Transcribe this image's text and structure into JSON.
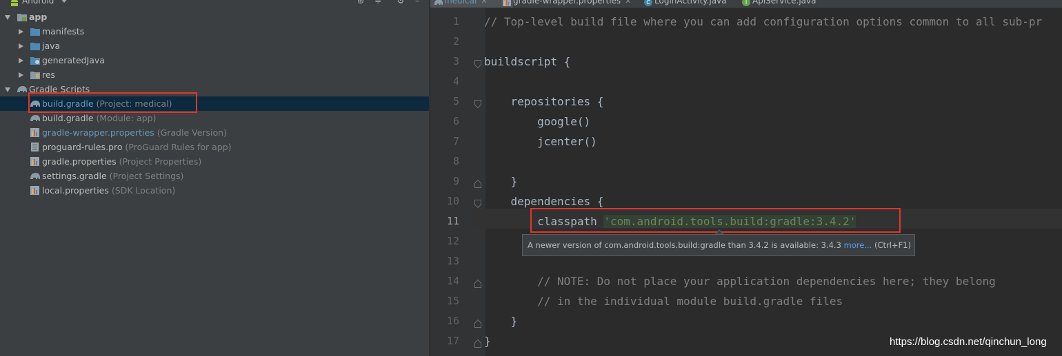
{
  "project_panel": {
    "view_label": "Android",
    "tree": [
      {
        "label": "app",
        "hint": "",
        "icon": "module-folder-icon",
        "expanded": true
      },
      {
        "label": "manifests",
        "hint": "",
        "icon": "folder-icon"
      },
      {
        "label": "java",
        "hint": "",
        "icon": "folder-icon"
      },
      {
        "label": "generatedJava",
        "hint": "",
        "icon": "generated-folder-icon"
      },
      {
        "label": "res",
        "hint": "",
        "icon": "res-folder-icon"
      },
      {
        "label": "Gradle Scripts",
        "hint": "",
        "icon": "gradle-elephant-icon",
        "expanded": true
      },
      {
        "label": "build.gradle",
        "hint": "(Project: medical)",
        "icon": "gradle-elephant-icon",
        "selected": true
      },
      {
        "label": "build.gradle",
        "hint": "(Module: app)",
        "icon": "gradle-elephant-icon"
      },
      {
        "label": "gradle-wrapper.properties",
        "hint": "(Gradle Version)",
        "icon": "properties-file-icon"
      },
      {
        "label": "proguard-rules.pro",
        "hint": "(ProGuard Rules for app)",
        "icon": "text-file-icon"
      },
      {
        "label": "gradle.properties",
        "hint": "(Project Properties)",
        "icon": "properties-file-icon"
      },
      {
        "label": "settings.gradle",
        "hint": "(Project Settings)",
        "icon": "gradle-elephant-icon"
      },
      {
        "label": "local.properties",
        "hint": "(SDK Location)",
        "icon": "properties-file-icon"
      }
    ]
  },
  "tabs": [
    {
      "label": "medical",
      "active": true
    },
    {
      "label": "gradle-wrapper.properties"
    },
    {
      "label": "LoginActivity.java"
    },
    {
      "label": "ApiService.java"
    }
  ],
  "editor": {
    "current_line": 11,
    "lines": [
      {
        "n": "1",
        "parts": [
          {
            "t": "// Top-level build file where you can add configuration options common to all sub-pr",
            "s": "comment"
          }
        ]
      },
      {
        "n": "2",
        "parts": []
      },
      {
        "n": "3",
        "parts": [
          {
            "t": "buildscript {",
            "s": "plain"
          }
        ]
      },
      {
        "n": "4",
        "parts": []
      },
      {
        "n": "5",
        "parts": [
          {
            "t": "    repositories {",
            "s": "plain"
          }
        ]
      },
      {
        "n": "6",
        "parts": [
          {
            "t": "        google()",
            "s": "plain"
          }
        ]
      },
      {
        "n": "7",
        "parts": [
          {
            "t": "        jcenter()",
            "s": "plain"
          }
        ]
      },
      {
        "n": "8",
        "parts": []
      },
      {
        "n": "9",
        "parts": [
          {
            "t": "    }",
            "s": "plain"
          }
        ]
      },
      {
        "n": "10",
        "parts": [
          {
            "t": "    dependencies {",
            "s": "plain"
          }
        ]
      },
      {
        "n": "11",
        "parts": [
          {
            "t": "        classpath ",
            "s": "plain"
          },
          {
            "t": "'com.android.tools.build:gradle:3.4.2'",
            "s": "string"
          }
        ]
      },
      {
        "n": "12",
        "parts": []
      },
      {
        "n": "13",
        "parts": []
      },
      {
        "n": "14",
        "parts": [
          {
            "t": "        // NOTE: Do not place your application dependencies here; they belong",
            "s": "comment"
          }
        ]
      },
      {
        "n": "15",
        "parts": [
          {
            "t": "        // in the individual module build.gradle files",
            "s": "comment"
          }
        ]
      },
      {
        "n": "16",
        "parts": [
          {
            "t": "    }",
            "s": "plain"
          }
        ]
      },
      {
        "n": "17",
        "parts": [
          {
            "t": "}",
            "s": "plain"
          }
        ]
      }
    ],
    "tooltip": {
      "text": "A newer version of com.android.tools.build:gradle than 3.4.2 is available: 3.4.3 ",
      "link": "more...",
      "shortcut": " (Ctrl+F1)"
    }
  },
  "watermark": "https://blog.csdn.net/qinchun_long",
  "colors": {
    "panel_bg": "#3c3f41",
    "editor_bg": "#2b2b2b",
    "selection": "#0d293e",
    "highlight_box": "#e0362d",
    "string": "#6a8759",
    "comment": "#808080"
  }
}
